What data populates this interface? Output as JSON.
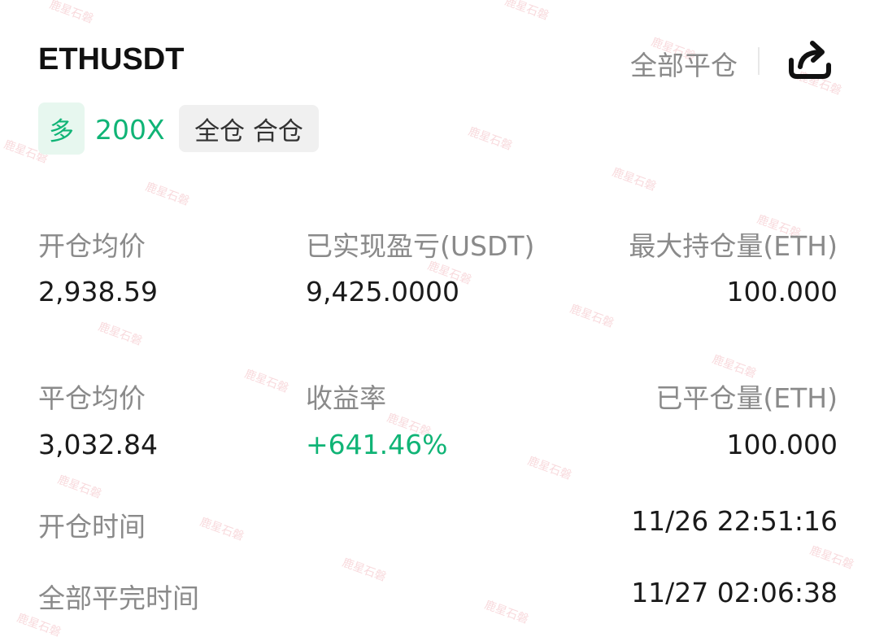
{
  "header": {
    "symbol": "ETHUSDT",
    "close_all_label": "全部平仓"
  },
  "tags": {
    "side": "多",
    "leverage": "200X",
    "margin_mode": "全仓 合仓"
  },
  "stats_row1": {
    "open_avg_label": "开仓均价",
    "open_avg_value": "2,938.59",
    "realized_pnl_label": "已实现盈亏(USDT)",
    "realized_pnl_value": "9,425.0000",
    "max_position_label": "最大持仓量(ETH)",
    "max_position_value": "100.000"
  },
  "stats_row2": {
    "close_avg_label": "平仓均价",
    "close_avg_value": "3,032.84",
    "roi_label": "收益率",
    "roi_value": "+641.46%",
    "closed_qty_label": "已平仓量(ETH)",
    "closed_qty_value": "100.000"
  },
  "times": {
    "open_time_label": "开仓时间",
    "open_time_value": "11/26 22:51:16",
    "full_close_label": "全部平完时间",
    "full_close_value": "11/27 02:06:38"
  },
  "watermark_text": "鹿星石磐",
  "colors": {
    "accent_green": "#10b476",
    "label_gray": "#8a8a8a",
    "tag_green_bg": "#e7f7ef",
    "tag_gray_bg": "#f0f0f0"
  },
  "icons": {
    "share": "share-icon"
  }
}
